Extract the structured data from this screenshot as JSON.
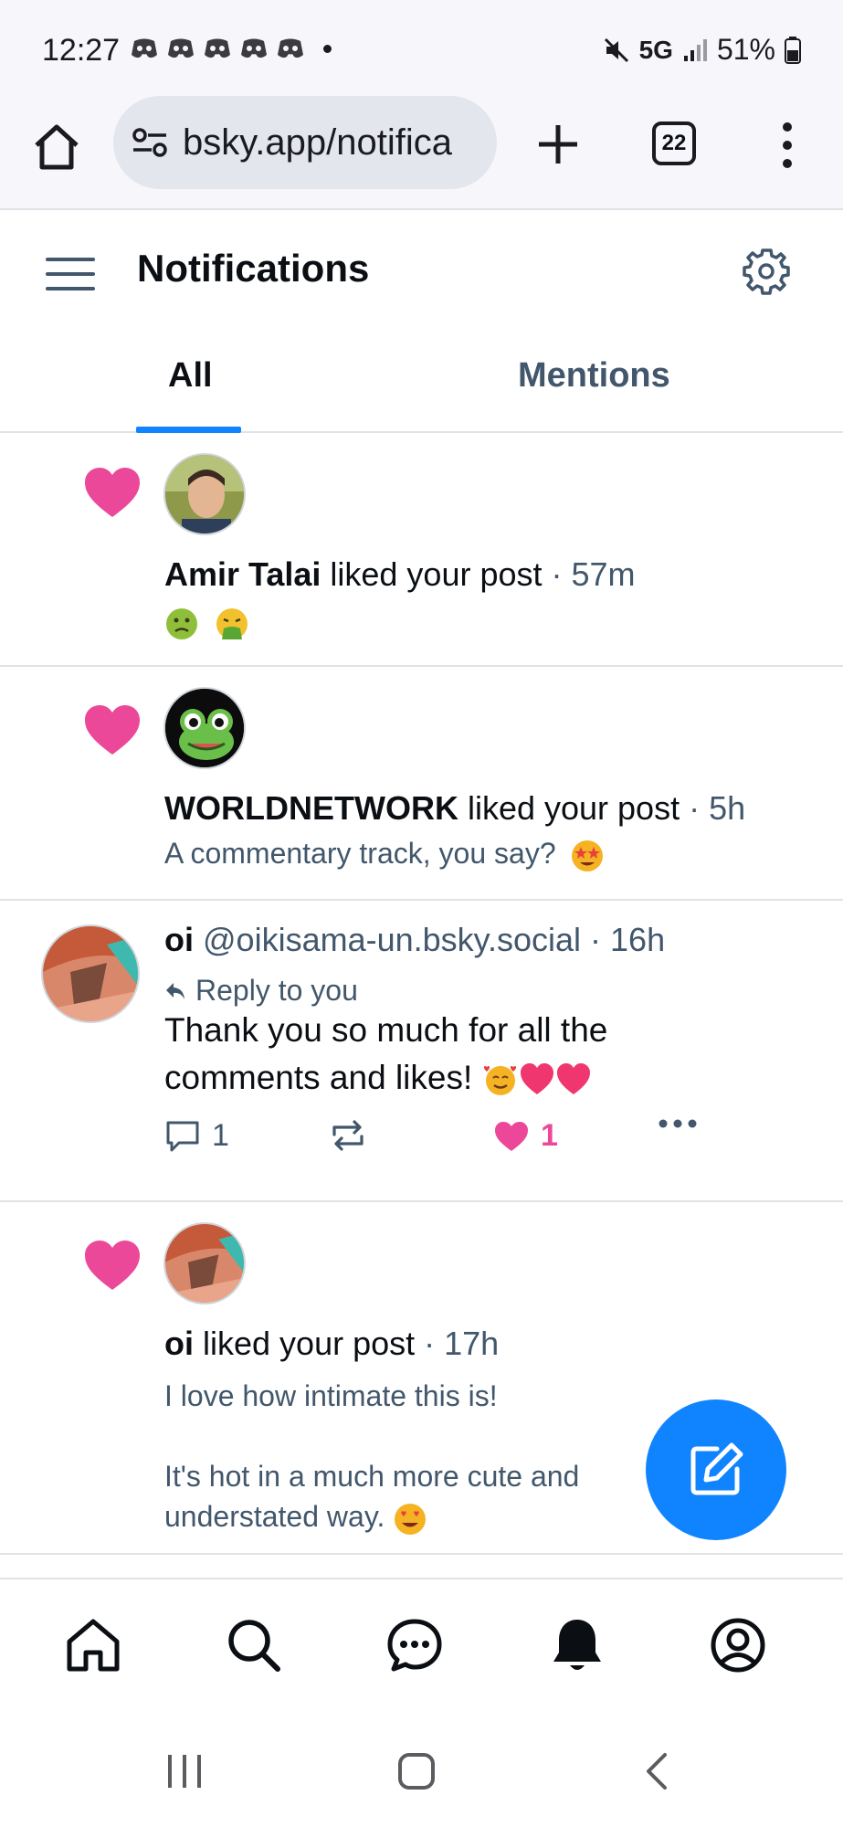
{
  "status_bar": {
    "time": "12:27",
    "network": "5G",
    "battery": "51%",
    "notification_icons": [
      "discord-icon",
      "discord-icon",
      "discord-icon",
      "discord-icon",
      "discord-icon"
    ]
  },
  "browser": {
    "url": "bsky.app/notifica",
    "tab_count": "22"
  },
  "header": {
    "title": "Notifications"
  },
  "tabs": [
    {
      "label": "All",
      "active": true
    },
    {
      "label": "Mentions",
      "active": false
    }
  ],
  "notifications": [
    {
      "type": "like",
      "name": "Amir Talai",
      "action": " liked your post",
      "time": " · 57m",
      "preview": ""
    },
    {
      "type": "like",
      "name": "WORLDNETWORK",
      "action": " liked your post",
      "time": " · 5h",
      "preview": "A commentary track, you say?"
    },
    {
      "type": "reply",
      "name": "oi",
      "handle": " @oikisama-un.bsky.social",
      "time": " · 16h",
      "reply_label": "Reply to you",
      "text": "Thank you so much for all the comments and likes!",
      "reply_count": "1",
      "like_count": "1"
    },
    {
      "type": "like",
      "name": "oi",
      "action": " liked your post",
      "time": " · 17h",
      "preview_line1": "I love how intimate this is!",
      "preview_line2": "It's hot in a much more cute and understated way."
    }
  ],
  "colors": {
    "accent": "#1083fe",
    "like": "#ec4899",
    "muted_text": "#42576c"
  }
}
